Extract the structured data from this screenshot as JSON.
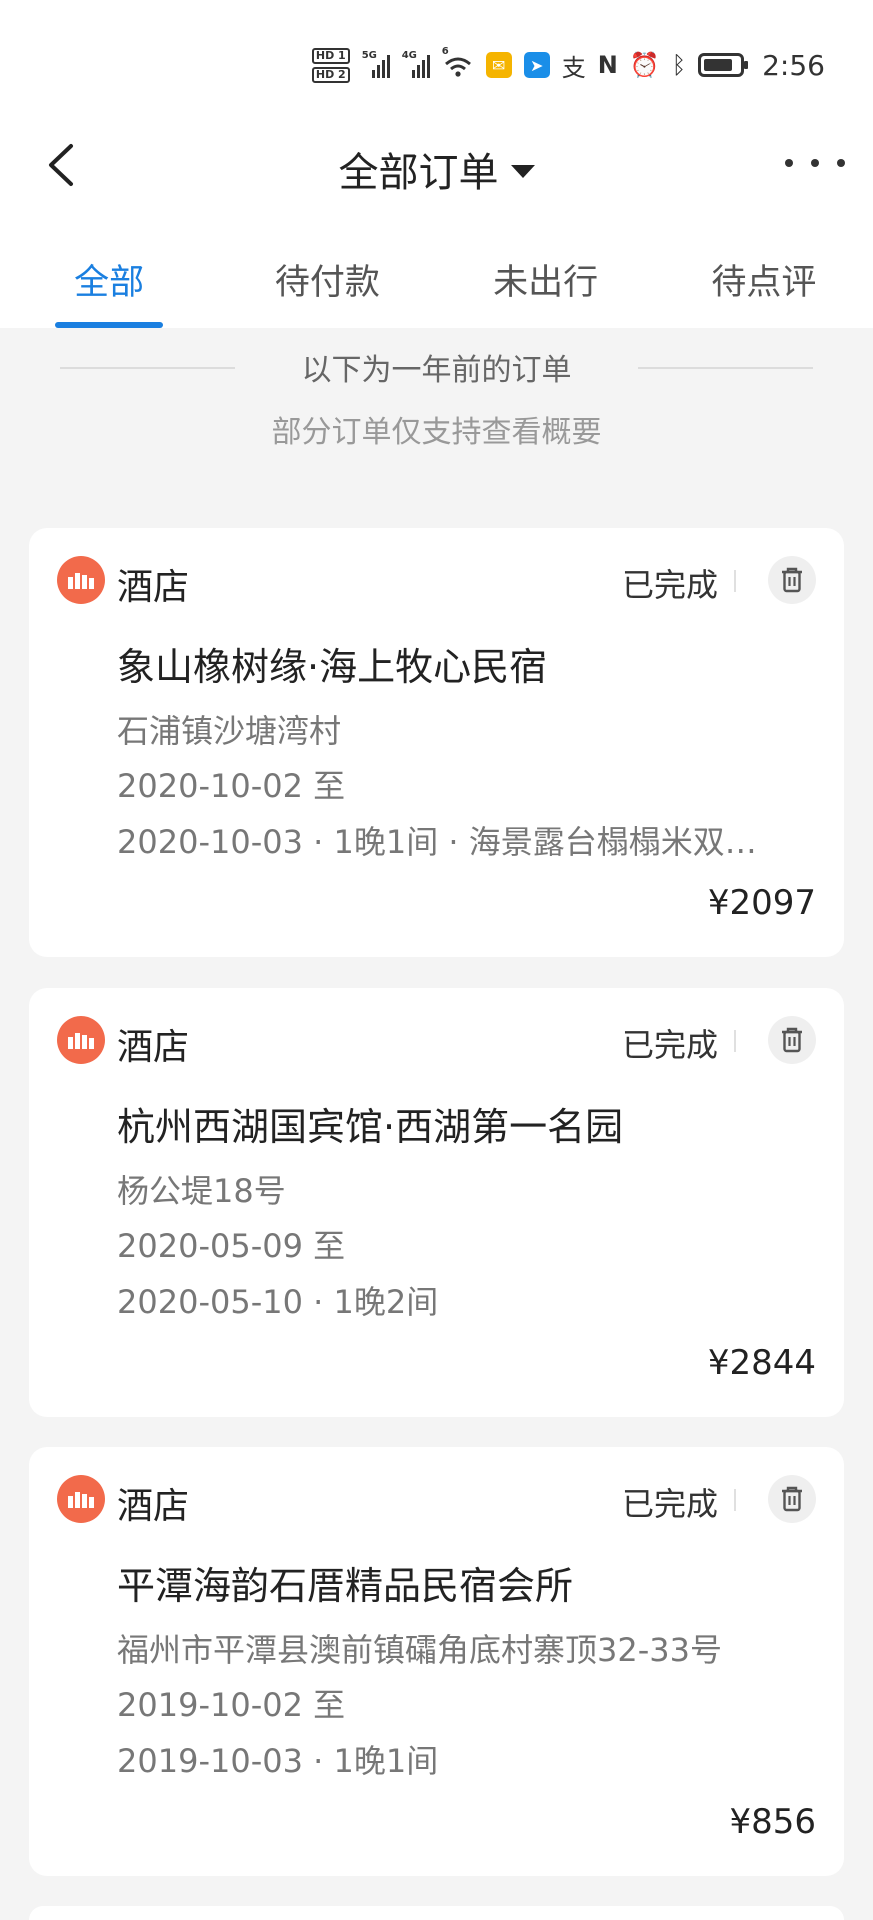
{
  "status_bar": {
    "hd1": "HD 1",
    "hd2": "HD 2",
    "sig1": "5G",
    "sig2": "4G",
    "wifi": "6",
    "time": "2:56"
  },
  "nav": {
    "title": "全部订单"
  },
  "tabs": [
    {
      "label": "全部",
      "active": true
    },
    {
      "label": "待付款",
      "active": false
    },
    {
      "label": "未出行",
      "active": false
    },
    {
      "label": "待点评",
      "active": false
    }
  ],
  "notice": {
    "line1": "以下为一年前的订单",
    "line2": "部分订单仅支持查看概要"
  },
  "orders": [
    {
      "category": "酒店",
      "status": "已完成",
      "name": "象山橡树缘·海上牧心民宿",
      "address": "石浦镇沙塘湾村",
      "date_from": "2020-10-02 至",
      "date_to": "2020-10-03 · 1晚1间 · 海景露台榻榻米双…",
      "price": "¥2097"
    },
    {
      "category": "酒店",
      "status": "已完成",
      "name": "杭州西湖国宾馆·西湖第一名园",
      "address": "杨公堤18号",
      "date_from": "2020-05-09 至",
      "date_to": "2020-05-10 · 1晚2间",
      "price": "¥2844"
    },
    {
      "category": "酒店",
      "status": "已完成",
      "name": "平潭海韵石厝精品民宿会所",
      "address": "福州市平潭县澳前镇礵角底村寨顶32-33号",
      "date_from": "2019-10-02 至",
      "date_to": "2019-10-03 · 1晚1间",
      "price": "¥856"
    }
  ],
  "colors": {
    "accent": "#1a7fe0",
    "hotel_logo": "#f26a4b",
    "background": "#f4f4f4"
  }
}
